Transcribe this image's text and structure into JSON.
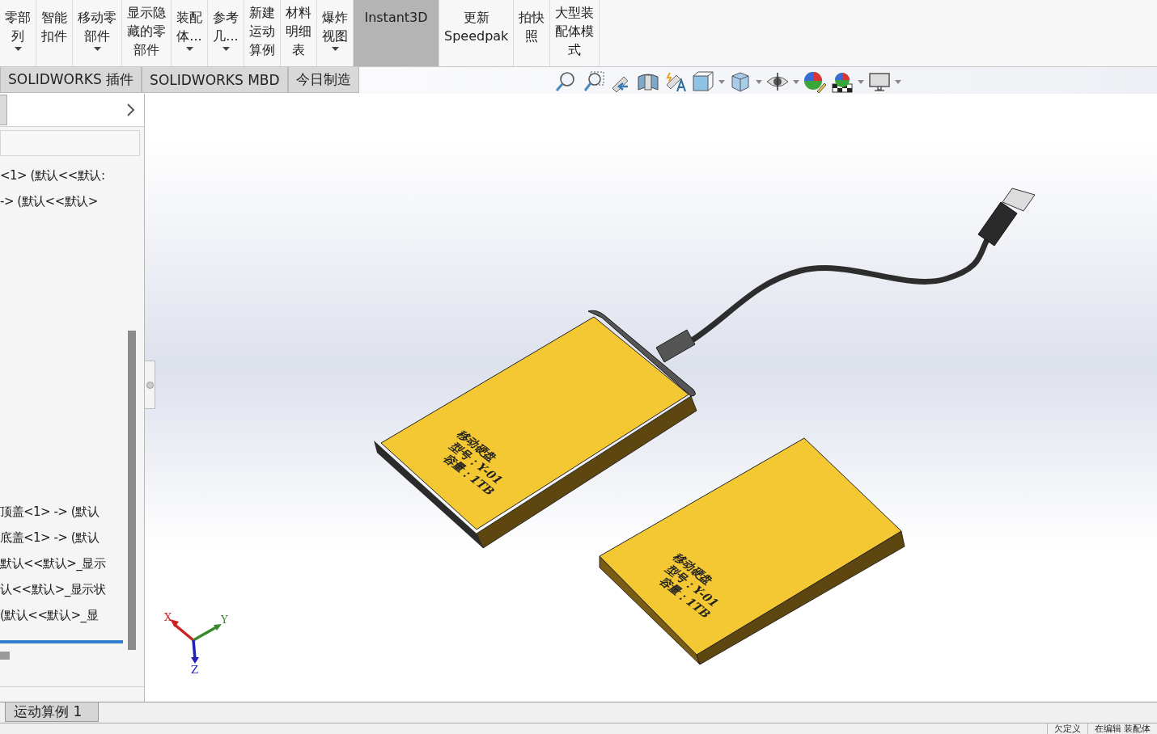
{
  "ribbon": {
    "buttons": [
      {
        "lines": [
          "零部",
          "列"
        ],
        "dropdown": true,
        "selected": false
      },
      {
        "lines": [
          "智能",
          "扣件"
        ],
        "dropdown": false,
        "selected": false
      },
      {
        "lines": [
          "移动零",
          "部件"
        ],
        "dropdown": true,
        "selected": false
      },
      {
        "lines": [
          "显示隐",
          "藏的零",
          "部件"
        ],
        "dropdown": false,
        "selected": false
      },
      {
        "lines": [
          "装配",
          "体..."
        ],
        "dropdown": true,
        "selected": false
      },
      {
        "lines": [
          "参考",
          "几..."
        ],
        "dropdown": true,
        "selected": false
      },
      {
        "lines": [
          "新建",
          "运动",
          "算例"
        ],
        "dropdown": false,
        "selected": false
      },
      {
        "lines": [
          "材料",
          "明细",
          "表"
        ],
        "dropdown": false,
        "selected": false
      },
      {
        "lines": [
          "爆炸",
          "视图"
        ],
        "dropdown": true,
        "selected": false
      },
      {
        "lines": [
          "Instant3D"
        ],
        "dropdown": false,
        "selected": true
      },
      {
        "lines": [
          "更新",
          "Speedpak"
        ],
        "dropdown": false,
        "selected": false
      },
      {
        "lines": [
          "拍快",
          "照"
        ],
        "dropdown": false,
        "selected": false
      },
      {
        "lines": [
          "大型装",
          "配体模",
          "式"
        ],
        "dropdown": false,
        "selected": false
      }
    ]
  },
  "command_tabs": [
    {
      "label": "SOLIDWORKS 插件"
    },
    {
      "label": "SOLIDWORKS MBD"
    },
    {
      "label": "今日制造"
    }
  ],
  "feature_tree": {
    "top_items": [
      "<1> (默认<<默认:",
      "-> (默认<<默认>"
    ],
    "bottom_items": [
      "顶盖<1> -> (默认",
      "底盖<1> -> (默认",
      "默认<<默认>_显示",
      "认<<默认>_显示状",
      "(默认<<默认>_显"
    ]
  },
  "model": {
    "engravings": [
      {
        "lines": [
          "移动硬盘",
          "型号：Y-01",
          "容量：1TB"
        ]
      },
      {
        "lines": [
          "移动硬盘",
          "型号：Y-01",
          "容量：1TB"
        ]
      }
    ]
  },
  "triad": {
    "x": "X",
    "y": "Y",
    "z": "Z"
  },
  "motion_tab": {
    "label": "运动算例 1"
  },
  "status_bar": [
    "欠定义",
    "在编辑 装配体"
  ]
}
